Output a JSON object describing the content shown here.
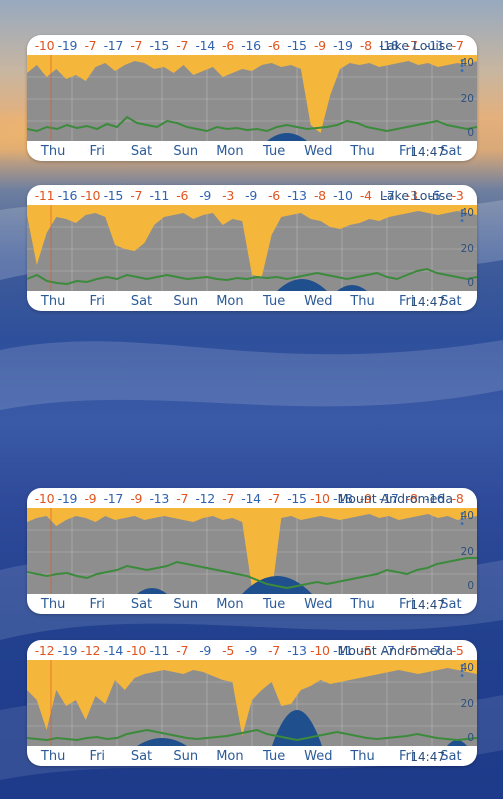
{
  "widgets": [
    {
      "station": "Lake Louise",
      "time": "14:47",
      "temps": [
        "-10",
        "-19",
        "-7",
        "-17",
        "-7",
        "-15",
        "-7",
        "-14",
        "-6",
        "-16",
        "-6",
        "-15",
        "-9",
        "-19",
        "-8",
        "-18",
        "-7",
        "-11",
        "-7"
      ],
      "days": [
        "Thu",
        "Fri",
        "Sat",
        "Sun",
        "Mon",
        "Tue",
        "Wed",
        "Thu",
        "Fri",
        "Sat"
      ],
      "ticks": [
        "40",
        "20",
        "0"
      ]
    },
    {
      "station": "Lake Louise",
      "time": "14:47",
      "temps": [
        "-11",
        "-16",
        "-10",
        "-15",
        "-7",
        "-11",
        "-6",
        "-9",
        "-3",
        "-9",
        "-6",
        "-13",
        "-8",
        "-10",
        "-4",
        "-7",
        "-3",
        "-5",
        "-3"
      ],
      "days": [
        "Thu",
        "Fri",
        "Sat",
        "Sun",
        "Mon",
        "Tue",
        "Wed",
        "Thu",
        "Fri",
        "Sat"
      ],
      "ticks": [
        "40",
        "20",
        "0"
      ]
    },
    {
      "station": "Mount Andromeda",
      "time": "14:47",
      "temps": [
        "-10",
        "-19",
        "-9",
        "-17",
        "-9",
        "-13",
        "-7",
        "-12",
        "-7",
        "-14",
        "-7",
        "-15",
        "-10",
        "-18",
        "-9",
        "-17",
        "-8",
        "-16",
        "-8"
      ],
      "days": [
        "Thu",
        "Fri",
        "Sat",
        "Sun",
        "Mon",
        "Tue",
        "Wed",
        "Thu",
        "Fri",
        "Sat"
      ],
      "ticks": [
        "40",
        "20",
        "0"
      ]
    },
    {
      "station": "Mount Andromeda",
      "time": "14:47",
      "temps": [
        "-12",
        "-19",
        "-12",
        "-14",
        "-10",
        "-11",
        "-7",
        "-9",
        "-5",
        "-9",
        "-7",
        "-13",
        "-10",
        "-11",
        "-5",
        "-7",
        "-5",
        "-7",
        "-5"
      ],
      "days": [
        "Thu",
        "Fri",
        "Sat",
        "Sun",
        "Mon",
        "Tue",
        "Wed",
        "Thu",
        "Fri",
        "Sat"
      ],
      "ticks": [
        "40",
        "20",
        "0"
      ]
    }
  ],
  "colors": {
    "temp_warm": "#e0541f",
    "temp_cold": "#2f63b0",
    "sun": "#f5b63c",
    "cloud": "#8e8e8e",
    "wind": "#3c8a3c",
    "precip": "#1f4f8c",
    "days_text": "#2b5a97"
  },
  "icons": {
    "menu": "vertical-dots-icon"
  }
}
